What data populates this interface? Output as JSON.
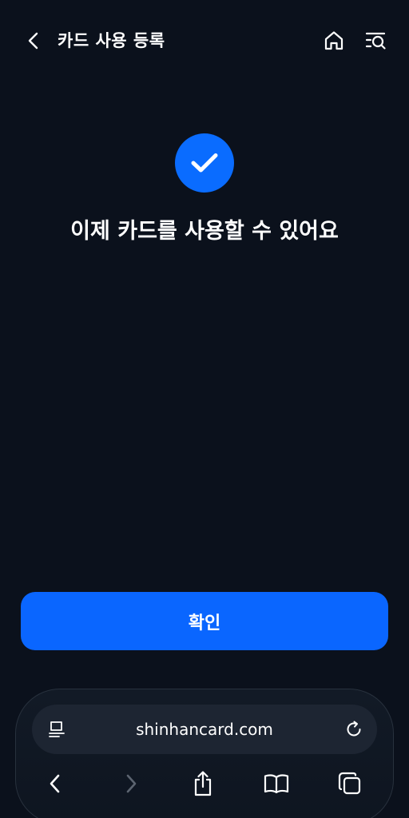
{
  "header": {
    "title": "카드 사용 등록",
    "back_icon": "chevron-left-icon",
    "home_icon": "home-icon",
    "menu_icon": "menu-search-icon"
  },
  "main": {
    "status_icon": "check-circle-icon",
    "message": "이제 카드를 사용할 수 있어요",
    "confirm_label": "확인"
  },
  "browser": {
    "url": "shinhancard.com",
    "reader_icon": "reader-icon",
    "reload_icon": "reload-icon",
    "toolbar_icons": [
      "back-icon",
      "forward-icon",
      "share-icon",
      "bookmarks-icon",
      "tabs-icon"
    ]
  },
  "colors": {
    "background": "#0b111c",
    "accent": "#0a66ff",
    "text": "#ffffff",
    "disabled": "#5c6470"
  }
}
